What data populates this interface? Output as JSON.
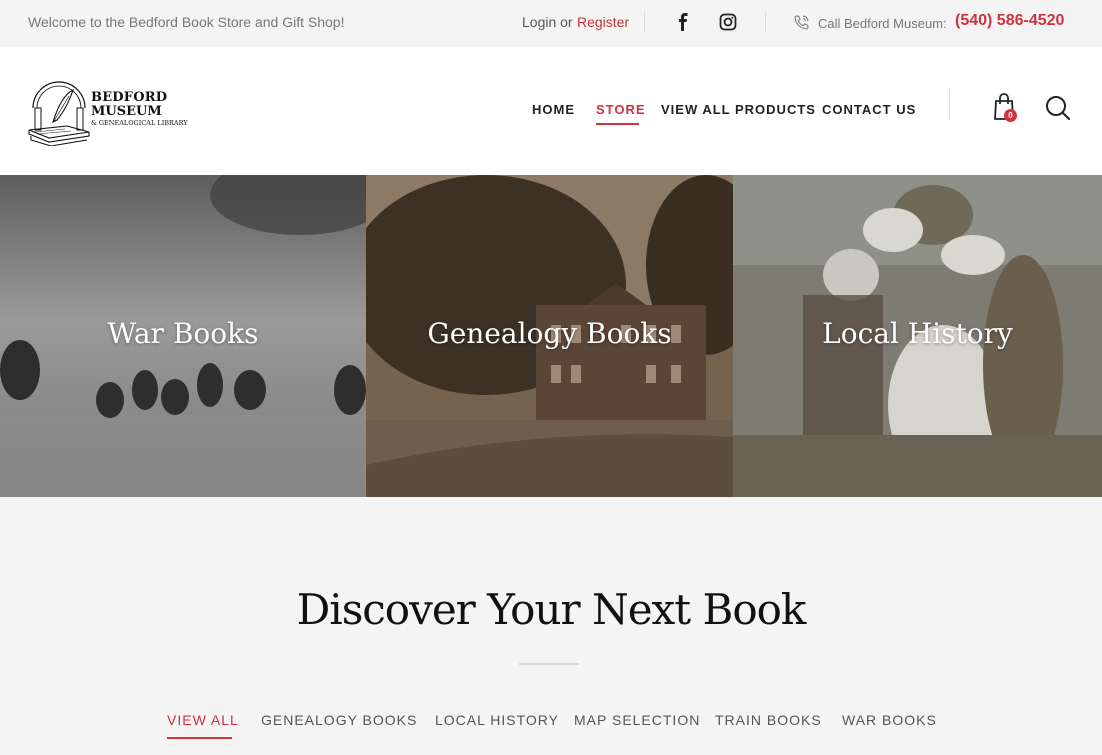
{
  "topbar": {
    "welcome": "Welcome to the Bedford Book Store and Gift Shop!",
    "login": "Login or",
    "register": "Register",
    "call_label": "Call Bedford Museum:",
    "phone": "(540) 586-4520",
    "icons": [
      "facebook-icon",
      "instagram-icon",
      "phone-icon"
    ]
  },
  "logo": {
    "line1": "BEDFORD",
    "line2": "MUSEUM",
    "line3": "& GENEALOGICAL LIBRARY"
  },
  "nav": {
    "items": [
      "HOME",
      "STORE",
      "VIEW ALL PRODUCTS",
      "CONTACT US"
    ],
    "active": "STORE",
    "cart_count": "0"
  },
  "tiles": [
    "War Books",
    "Genealogy Books",
    "Local History"
  ],
  "discover": {
    "heading": "Discover Your Next Book",
    "filters": [
      "VIEW ALL",
      "GENEALOGY BOOKS",
      "LOCAL HISTORY",
      "MAP SELECTION",
      "TRAIN BOOKS",
      "WAR BOOKS"
    ],
    "active_filter": "VIEW ALL"
  },
  "colors": {
    "accent": "#d0323e",
    "text": "#222222",
    "background": "#f4f4f4"
  }
}
